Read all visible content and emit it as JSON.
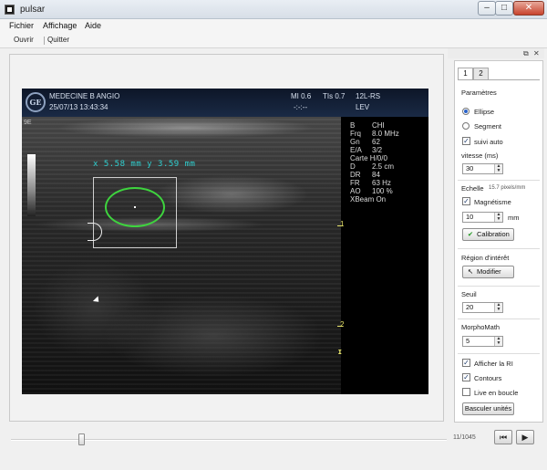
{
  "window": {
    "title": "pulsar",
    "min": "–",
    "max": "□",
    "close": "✕"
  },
  "menu": [
    "Fichier",
    "Affichage",
    "Aide"
  ],
  "toolbar": {
    "open": "Ouvrir",
    "quit": "Quitter"
  },
  "ultrasound": {
    "brand_logo": "GE",
    "header_left1": "MEDECINE B ANGIO",
    "header_left2": "25/07/13 13:43:34",
    "header_mi": "MI 0.6",
    "header_tis": "TIs 0.7",
    "header_probe": "12L-RS",
    "header_dashes": "-:-:--",
    "header_lev": "LEV",
    "corner": "9E",
    "measurement": "x 5.58 mm y 3.59 mm",
    "params": [
      {
        "k": "B",
        "v": "CHI"
      },
      {
        "k": "Frq",
        "v": "8.0 MHz"
      },
      {
        "k": "Gn",
        "v": "62"
      },
      {
        "k": "E/A",
        "v": "3/2"
      },
      {
        "k": "Carte H/0/0",
        "v": ""
      },
      {
        "k": "D",
        "v": "2.5 cm"
      },
      {
        "k": "DR",
        "v": "84"
      },
      {
        "k": "FR",
        "v": "63 Hz"
      },
      {
        "k": "AO",
        "v": "100 %"
      },
      {
        "k": "XBeam On",
        "v": ""
      }
    ],
    "depth_marks": [
      "1",
      "2"
    ]
  },
  "playback": {
    "counter": "11/1045",
    "prev": "⏮",
    "play": "▶"
  },
  "panel": {
    "tabs": [
      "1",
      "2"
    ],
    "parametres": "Paramètres",
    "ellipse": "Ellipse",
    "segment": "Segment",
    "suivi_auto": "suivi auto",
    "vitesse": "vitesse (ms)",
    "vitesse_val": "30",
    "echelle": "Echelle",
    "echelle_val": "15.7 pixels/mm",
    "magnetisme": "Magnétisme",
    "magnetisme_val": "10",
    "unit": "mm",
    "calibration": "Calibration",
    "region": "Région d'intérêt",
    "modifier": "Modifier",
    "seuil": "Seuil",
    "seuil_val": "20",
    "morpho": "MorphoMath",
    "morpho_val": "5",
    "afficher_ri": "Afficher la RI",
    "contours": "Contours",
    "live": "Live en boucle",
    "basculer": "Basculer unités"
  }
}
